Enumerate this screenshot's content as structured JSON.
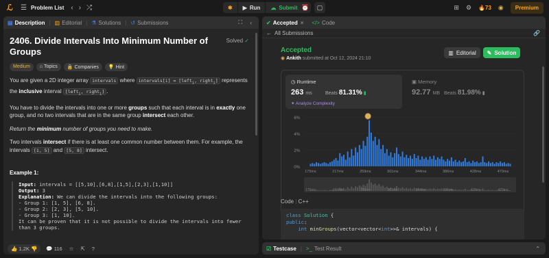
{
  "topbar": {
    "problem_list": "Problem List",
    "run": "Run",
    "submit": "Submit",
    "streak": "73",
    "premium": "Premium"
  },
  "left": {
    "tabs": [
      "Description",
      "Editorial",
      "Solutions",
      "Submissions"
    ],
    "title": "2406. Divide Intervals Into Minimum Number of Groups",
    "solved": "Solved",
    "tags": [
      "Medium",
      "Topics",
      "Companies",
      "Hint"
    ],
    "p1": {
      "a": "You are given a 2D integer array ",
      "c1": "intervals",
      "b": " where ",
      "c2": "intervals[i] = [left",
      "c2s": "i",
      "c2b": ", right",
      "c2c": "]",
      "c": " represents the ",
      "d": "inclusive",
      "e": " interval ",
      "c3": "[left",
      "c3b": ", right",
      "c3c": "]",
      "f": "."
    },
    "p2": {
      "a": "You have to divide the intervals into one or more ",
      "b": "groups",
      "c": " such that each interval is in ",
      "d": "exactly",
      "e": " one group, and no two intervals that are in the same group ",
      "f": "intersect",
      "g": " each other."
    },
    "p3": {
      "a": "Return the ",
      "b": "minimum",
      "c": " number of groups you need to make."
    },
    "p4": {
      "a": "Two intervals ",
      "b": "intersect",
      "c": " if there is at least one common number between them. For example, the intervals ",
      "c1": "[1, 5]",
      "d": " and ",
      "c2": "[5, 8]",
      "e": " intersect."
    },
    "example_heading": "Example 1:",
    "example": {
      "input_label": "Input:",
      "input": " intervals = [[5,10],[6,8],[1,5],[2,3],[1,10]]",
      "output_label": "Output:",
      "output": " 3",
      "explanation_label": "Explanation:",
      "explanation": " We can divide the intervals into the following groups:",
      "lines": [
        "- Group 1: [1, 5], [6, 8].",
        "- Group 2: [2, 3], [5, 10].",
        "- Group 3: [1, 10].",
        "It can be proven that it is not possible to divide the intervals into fewer",
        "than 3 groups."
      ]
    },
    "footer": {
      "likes": "1.2K",
      "comments": "116"
    }
  },
  "right": {
    "tabs": [
      "Accepted",
      "Code"
    ],
    "all_submissions": "All Submissions",
    "accepted": "Accepted",
    "author": "Ankith",
    "submitted": " submitted at Oct 12, 2024 21:10",
    "editorial_btn": "Editorial",
    "solution_btn": "Solution",
    "runtime": {
      "title": "Runtime",
      "value": "263",
      "unit": "ms",
      "beats_label": "Beats",
      "beats": "81.31%",
      "analyze": "Analyze Complexity"
    },
    "memory": {
      "title": "Memory",
      "value": "92.77",
      "unit": "MB",
      "beats_label": "Beats",
      "beats": "81.98%"
    },
    "code_label": "Code",
    "code_lang": "C++",
    "code_lines": [
      [
        "kw",
        "class "
      ],
      [
        "ty",
        "Solution"
      ],
      [
        "",
        " {"
      ],
      [
        "nl",
        ""
      ],
      [
        "kw",
        "public"
      ],
      [
        "",
        ":"
      ],
      [
        "nl",
        ""
      ],
      [
        "",
        "    "
      ],
      [
        "kw",
        "int "
      ],
      [
        "fn",
        "minGroups"
      ],
      [
        "",
        "(vector<vector<"
      ],
      [
        "kw",
        "int"
      ],
      [
        "",
        ">>& intervals) {"
      ]
    ],
    "testcase_tabs": [
      "Testcase",
      "Test Result"
    ]
  },
  "chart_data": {
    "type": "bar",
    "ylabel": "",
    "xlabel": "",
    "yticks": [
      "6%",
      "4%",
      "2%",
      "0%"
    ],
    "ylim": [
      0,
      6
    ],
    "xticks": [
      "175ms",
      "217ms",
      "259ms",
      "301ms",
      "344ms",
      "386ms",
      "428ms",
      "470ms"
    ],
    "xlim": [
      165,
      490
    ],
    "highlight_x": 263,
    "bar_width_ms": 3,
    "values": [
      [
        175,
        0.3
      ],
      [
        178,
        0.4
      ],
      [
        181,
        0.3
      ],
      [
        184,
        0.5
      ],
      [
        187,
        0.4
      ],
      [
        190,
        0.3
      ],
      [
        193,
        0.4
      ],
      [
        196,
        0.5
      ],
      [
        199,
        0.4
      ],
      [
        202,
        0.3
      ],
      [
        205,
        0.5
      ],
      [
        208,
        0.6
      ],
      [
        211,
        0.8
      ],
      [
        214,
        1.0
      ],
      [
        217,
        0.7
      ],
      [
        220,
        1.6
      ],
      [
        223,
        1.2
      ],
      [
        226,
        1.4
      ],
      [
        229,
        0.8
      ],
      [
        232,
        1.8
      ],
      [
        235,
        1.1
      ],
      [
        238,
        2.1
      ],
      [
        241,
        1.3
      ],
      [
        244,
        2.3
      ],
      [
        247,
        1.7
      ],
      [
        250,
        2.6
      ],
      [
        253,
        2.1
      ],
      [
        256,
        3.1
      ],
      [
        259,
        2.5
      ],
      [
        262,
        3.6
      ],
      [
        265,
        5.6
      ],
      [
        268,
        4.1
      ],
      [
        271,
        3.1
      ],
      [
        274,
        3.6
      ],
      [
        277,
        2.6
      ],
      [
        280,
        3.3
      ],
      [
        283,
        2.1
      ],
      [
        286,
        2.6
      ],
      [
        289,
        1.6
      ],
      [
        292,
        2.1
      ],
      [
        295,
        1.3
      ],
      [
        298,
        1.7
      ],
      [
        301,
        1.1
      ],
      [
        304,
        1.6
      ],
      [
        307,
        2.3
      ],
      [
        310,
        1.5
      ],
      [
        313,
        1.2
      ],
      [
        316,
        1.8
      ],
      [
        319,
        1.1
      ],
      [
        322,
        1.4
      ],
      [
        325,
        1.0
      ],
      [
        328,
        1.3
      ],
      [
        331,
        0.9
      ],
      [
        334,
        1.5
      ],
      [
        337,
        1.0
      ],
      [
        340,
        1.3
      ],
      [
        343,
        0.8
      ],
      [
        346,
        1.2
      ],
      [
        349,
        0.9
      ],
      [
        352,
        1.1
      ],
      [
        355,
        0.8
      ],
      [
        358,
        1.2
      ],
      [
        361,
        0.9
      ],
      [
        364,
        1.3
      ],
      [
        367,
        0.8
      ],
      [
        370,
        1.1
      ],
      [
        373,
        0.9
      ],
      [
        376,
        1.2
      ],
      [
        379,
        0.8
      ],
      [
        382,
        0.6
      ],
      [
        385,
        0.9
      ],
      [
        388,
        0.7
      ],
      [
        391,
        1.1
      ],
      [
        394,
        0.6
      ],
      [
        397,
        0.8
      ],
      [
        400,
        0.5
      ],
      [
        403,
        0.7
      ],
      [
        406,
        0.5
      ],
      [
        409,
        0.6
      ],
      [
        412,
        1.0
      ],
      [
        415,
        0.5
      ],
      [
        418,
        0.6
      ],
      [
        421,
        0.4
      ],
      [
        424,
        0.7
      ],
      [
        427,
        0.5
      ],
      [
        430,
        0.6
      ],
      [
        433,
        0.4
      ],
      [
        436,
        0.5
      ],
      [
        439,
        1.2
      ],
      [
        442,
        0.5
      ],
      [
        445,
        0.4
      ],
      [
        448,
        0.6
      ],
      [
        451,
        0.4
      ],
      [
        454,
        0.5
      ],
      [
        457,
        0.3
      ],
      [
        460,
        0.5
      ],
      [
        463,
        0.4
      ],
      [
        466,
        0.6
      ],
      [
        469,
        0.4
      ],
      [
        472,
        0.5
      ],
      [
        475,
        0.3
      ],
      [
        478,
        0.4
      ],
      [
        481,
        0.3
      ]
    ],
    "colors": {
      "bar": "#2f7de1",
      "grid": "#3a3a3a"
    }
  }
}
